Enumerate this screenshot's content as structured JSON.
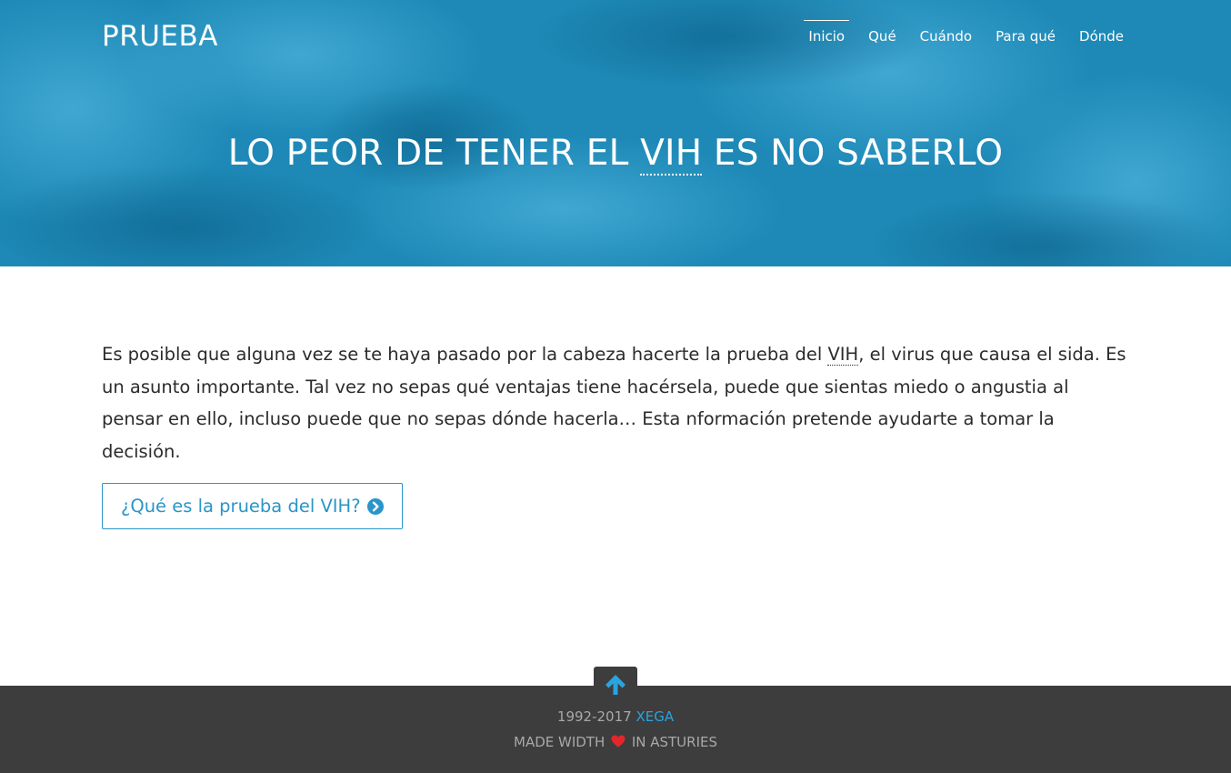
{
  "header": {
    "brand": "PRUEBA",
    "nav": [
      {
        "label": "Inicio",
        "active": true
      },
      {
        "label": "Qué",
        "active": false
      },
      {
        "label": "Cuándo",
        "active": false
      },
      {
        "label": "Para qué",
        "active": false
      },
      {
        "label": "Dónde",
        "active": false
      }
    ]
  },
  "hero": {
    "title_before": "LO PEOR DE TENER EL ",
    "title_abbr": "VIH",
    "title_after": " ES NO SABERLO"
  },
  "main": {
    "intro_before": "Es posible que alguna vez se te haya pasado por la cabeza hacerte la prueba del ",
    "intro_abbr": "VIH",
    "intro_after": ", el virus que causa el sida. Es un asunto importante. Tal vez no sepas qué ventajas tiene hacérsela, puede que sientas miedo o angustia al pensar en ello, incluso puede que no sepas dónde hacerla… Esta nformación pretende ayudarte a tomar la decisión.",
    "cta_label": "¿Qué es la prueba del VIH?",
    "cta_icon": "chevron-circle-right-icon"
  },
  "footer": {
    "years": "1992-2017",
    "org_link": "XEGA",
    "made_before": "MADE WIDTH",
    "made_after": "IN ASTURIES",
    "heart_icon": "heart-icon",
    "to_top_icon": "arrow-up-icon"
  },
  "colors": {
    "hero_overlay": "#1f8ab8",
    "accent": "#2a95c9",
    "footer_bg": "#3d3d3d",
    "footer_link": "#2aa3de",
    "heart": "#e3262b"
  }
}
